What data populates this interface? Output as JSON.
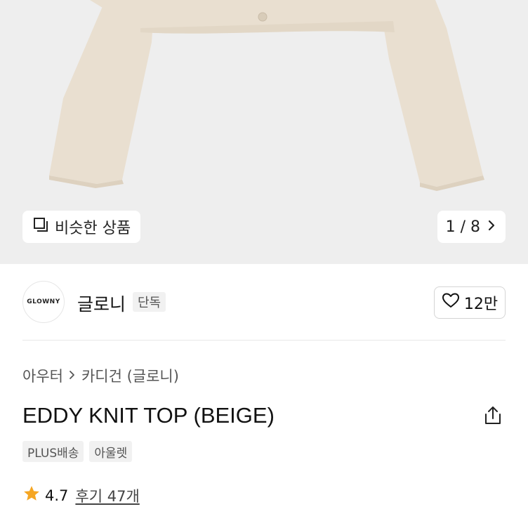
{
  "gallery": {
    "similar_label": "비슷한 상품",
    "page_indicator": "1 / 8"
  },
  "brand": {
    "logo_text": "GLOWNY",
    "name": "글로니",
    "badge": "단독",
    "like_count": "12만"
  },
  "breadcrumb": {
    "items": [
      "아우터",
      "카디건 (글로니)"
    ]
  },
  "product": {
    "title": "EDDY KNIT TOP (BEIGE)",
    "tags": [
      "PLUS배송",
      "아울렛"
    ],
    "rating": "4.7",
    "reviews": "후기 47개"
  },
  "colors": {
    "garment": "#e9dfd0",
    "star": "#f5a623"
  }
}
